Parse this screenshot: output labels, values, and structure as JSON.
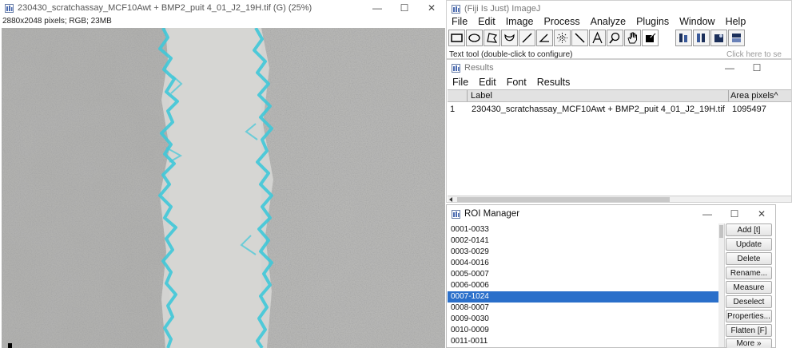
{
  "image_window": {
    "title": "230430_scratchassay_MCF10Awt + BMP2_puit 4_01_J2_19H.tif (G) (25%)",
    "info": "2880x2048 pixels; RGB; 23MB",
    "minimize": "—",
    "maximize": "☐",
    "close": "✕"
  },
  "fiji_window": {
    "title": "(Fiji Is Just) ImageJ",
    "menu": [
      "File",
      "Edit",
      "Image",
      "Process",
      "Analyze",
      "Plugins",
      "Window",
      "Help"
    ],
    "status": "Text tool (double-click to configure)",
    "click_here": "Click here to se",
    "tools": [
      "rectangle-tool-icon",
      "oval-tool-icon",
      "polygon-tool-icon",
      "freehand-tool-icon",
      "line-tool-icon",
      "angle-tool-icon",
      "multipoint-tool-icon",
      "wand-tool-icon",
      "text-tool-icon",
      "magnifier-icon",
      "hand-tool-icon",
      "color-picker-icon",
      "stack-tools-icon",
      "lut-icon",
      "developer-menu-icon",
      "roi-menu-icon"
    ]
  },
  "results_window": {
    "title": "Results",
    "menu": [
      "File",
      "Edit",
      "Font",
      "Results"
    ],
    "columns": [
      "",
      "Label",
      "Area pixels^"
    ],
    "rows": [
      [
        "1",
        "230430_scratchassay_MCF10Awt + BMP2_puit 4_01_J2_19H.tif",
        "1095497"
      ]
    ],
    "minimize": "—",
    "maximize": "☐"
  },
  "roi_manager": {
    "title": "ROI Manager",
    "items": [
      "0001-0033",
      "0002-0141",
      "0003-0029",
      "0004-0016",
      "0005-0007",
      "0006-0006",
      "0007-1024",
      "0008-0007",
      "0009-0030",
      "0010-0009",
      "0011-0011"
    ],
    "selected_index": 6,
    "buttons": [
      "Add [t]",
      "Update",
      "Delete",
      "Rename...",
      "Measure",
      "Deselect",
      "Properties...",
      "Flatten [F]",
      "More »"
    ],
    "minimize": "—",
    "maximize": "☐",
    "close": "✕"
  },
  "colors": {
    "roi_outline": "#3fc8d8",
    "selection": "#2a6fca",
    "cell_background": "#b4b4b2",
    "scratch": "#d2d2d0"
  }
}
